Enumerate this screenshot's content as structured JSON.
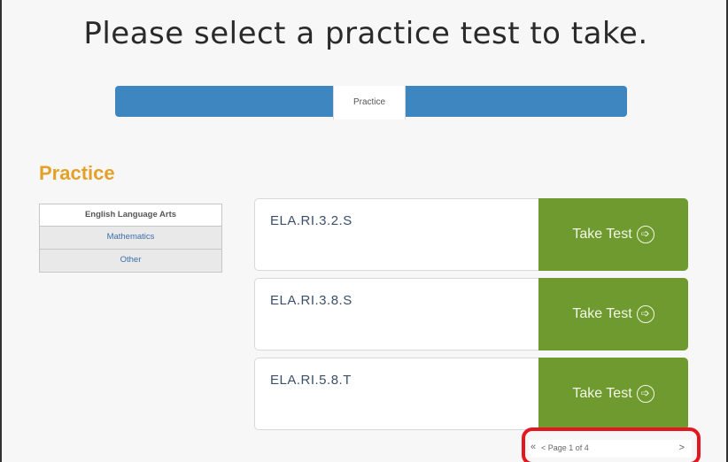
{
  "header": {
    "title": "Please select a practice test to take."
  },
  "tabs": {
    "active_label": "Practice"
  },
  "section": {
    "heading": "Practice"
  },
  "subjects": [
    {
      "label": "English Language Arts",
      "selected": true
    },
    {
      "label": "Mathematics",
      "selected": false
    },
    {
      "label": "Other",
      "selected": false
    }
  ],
  "tests": [
    {
      "name": "ELA.RI.3.2.S",
      "button_label": "Take Test"
    },
    {
      "name": "ELA.RI.3.8.S",
      "button_label": "Take Test"
    },
    {
      "name": "ELA.RI.5.8.T",
      "button_label": "Take Test"
    }
  ],
  "pager": {
    "first_symbol": "«",
    "label": "< Page 1 of 4",
    "next_symbol": ">"
  },
  "colors": {
    "tab_bar": "#3d86c0",
    "heading": "#e4a12a",
    "take_test_button": "#6f9a2f",
    "pager_highlight": "#e4161f"
  }
}
